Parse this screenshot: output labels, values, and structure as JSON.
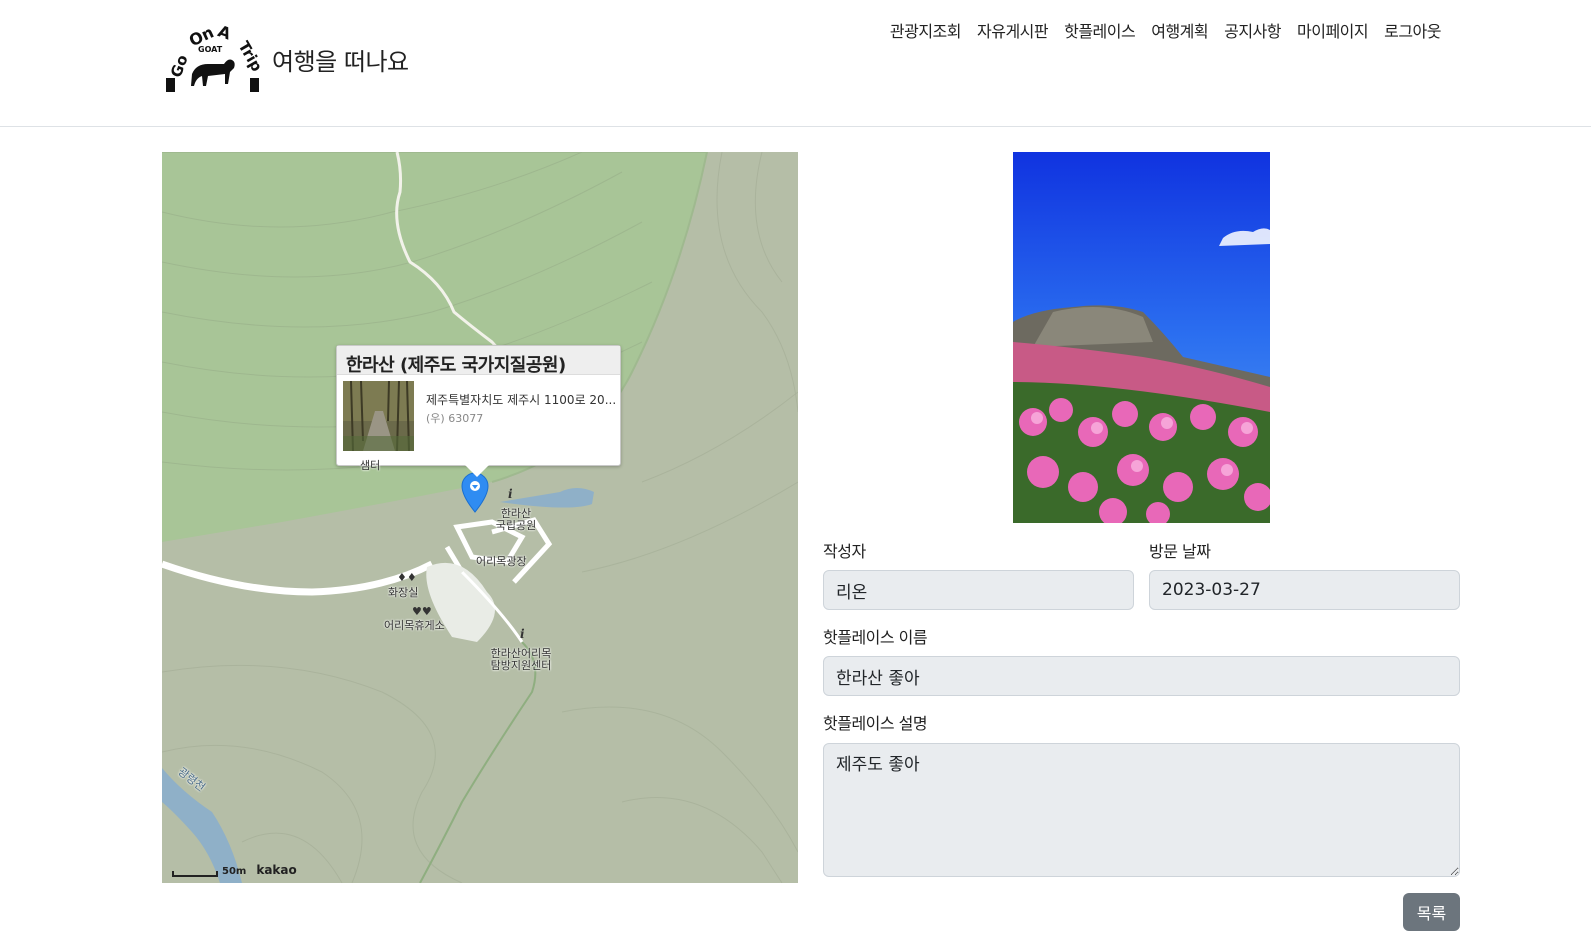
{
  "header": {
    "logo_alt": "GoOnATrip GOAT",
    "site_title": "여행을 떠나요",
    "nav": [
      "관광지조회",
      "자유게시판",
      "핫플레이스",
      "여행계획",
      "공지사항",
      "마이페이지",
      "로그아웃"
    ]
  },
  "map": {
    "infowindow": {
      "title": "한라산 (제주도 국가지질공원)",
      "address": "제주특별자치도 제주시 1100로 20...",
      "zipcode": "(우) 63077"
    },
    "labels": {
      "center": "샘터",
      "park": "한라산\n국립공원",
      "plaza": "어리목광장",
      "restroom": "화장실",
      "restarea": "어리목휴게소",
      "support": "한라산어리목\n탐방지원센터",
      "stream": "광령천"
    },
    "scale": "50m",
    "provider": "kakao",
    "colors": {
      "ground": "#b7bfa9",
      "forest": "#a6c495",
      "marker": "#2f8cf2"
    }
  },
  "form": {
    "author_label": "작성자",
    "author_value": "리온",
    "date_label": "방문 날짜",
    "date_value": "2023-03-27",
    "name_label": "핫플레이스 이름",
    "name_value": "한라산 좋아",
    "desc_label": "핫플레이스 설명",
    "desc_value": "제주도 좋아",
    "list_button": "목록"
  }
}
